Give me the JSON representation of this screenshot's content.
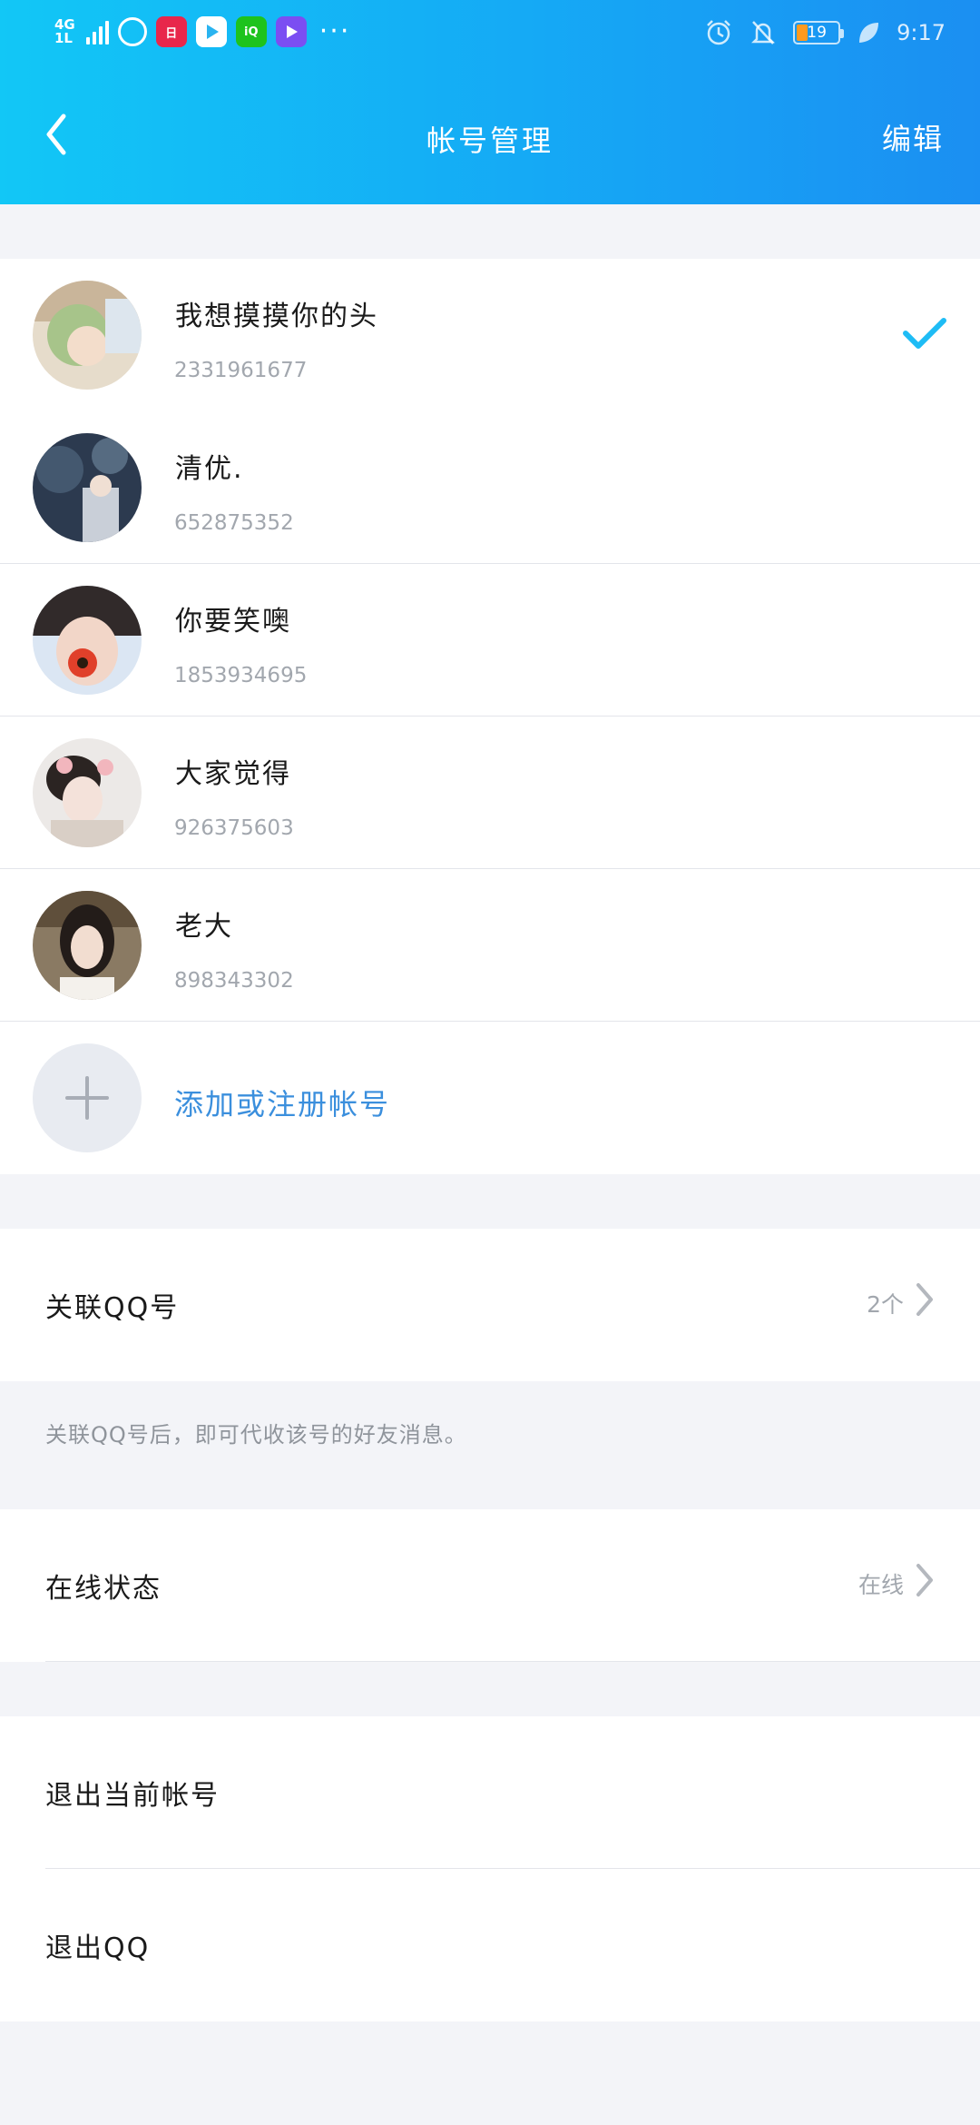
{
  "status_bar": {
    "network": "4G",
    "network_sub": "1L",
    "time": "9:17",
    "battery": "19",
    "more": "···",
    "app_icons": [
      {
        "name": "netease-music-icon",
        "color": "#ffffff"
      },
      {
        "name": "calendar-app-icon",
        "color": "#e8274b"
      },
      {
        "name": "video-player-icon",
        "color": "#ffffff"
      },
      {
        "name": "iqiyi-icon",
        "color": "#1ec31d"
      },
      {
        "name": "media-app-icon",
        "color": "#7b4ef2"
      }
    ]
  },
  "header": {
    "title": "帐号管理",
    "edit_label": "编辑",
    "gradient_start": "#12c7f6",
    "gradient_end": "#1b8ff2"
  },
  "accounts": [
    {
      "name": "我想摸摸你的头",
      "qq": "2331961677",
      "selected": true
    },
    {
      "name": "清优.",
      "qq": "652875352",
      "selected": false
    },
    {
      "name": "你要笑噢",
      "qq": "1853934695",
      "selected": false
    },
    {
      "name": "大家觉得",
      "qq": "926375603",
      "selected": false
    },
    {
      "name": "老大",
      "qq": "898343302",
      "selected": false
    }
  ],
  "add_account_label": "添加或注册帐号",
  "linked_qq": {
    "label": "关联QQ号",
    "value": "2个"
  },
  "linked_note": "关联QQ号后，即可代收该号的好友消息。",
  "online_status": {
    "label": "在线状态",
    "value": "在线"
  },
  "logout_current_label": "退出当前帐号",
  "logout_qq_label": "退出QQ",
  "colors": {
    "accent": "#3b8fdd",
    "check": "#1ebcf5",
    "secondary_text": "#a2a7ae"
  }
}
